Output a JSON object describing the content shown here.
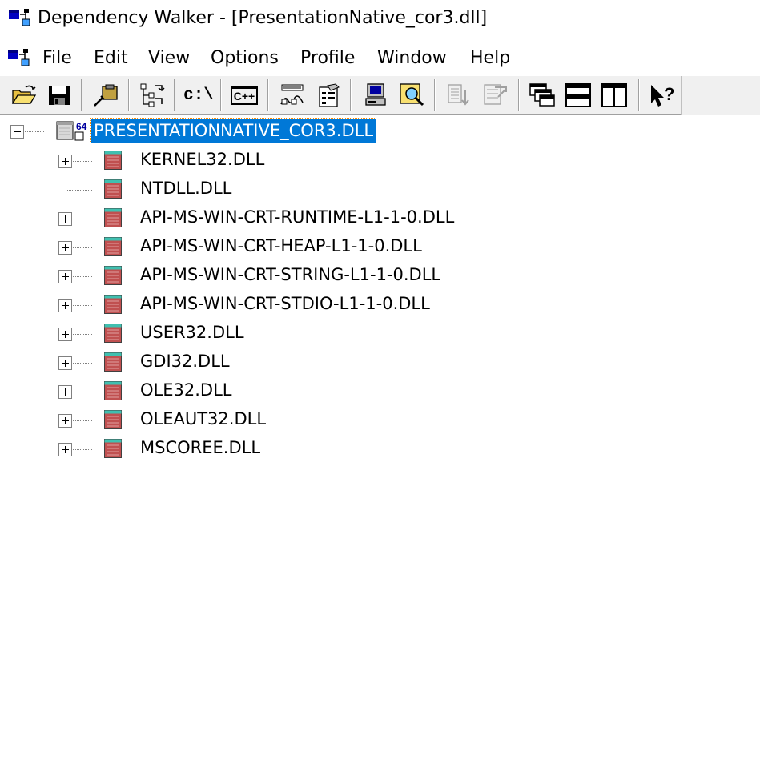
{
  "window": {
    "title": "Dependency Walker - [PresentationNative_cor3.dll]",
    "app_icon": "dependency-walker-icon"
  },
  "menu": {
    "icon": "dependency-walker-icon",
    "items": [
      "File",
      "Edit",
      "View",
      "Options",
      "Profile",
      "Window",
      "Help"
    ]
  },
  "toolbar": {
    "buttons": [
      {
        "name": "open-icon"
      },
      {
        "name": "save-icon"
      },
      {
        "name": "copy-icon"
      },
      {
        "name": "view-full-paths-icon",
        "text": ""
      },
      {
        "name": "path-icon",
        "text": "c:\\"
      },
      {
        "name": "undecorate-cpp-icon",
        "text": "C++"
      },
      {
        "name": "view-modules-icon"
      },
      {
        "name": "properties-icon"
      },
      {
        "name": "system-information-icon"
      },
      {
        "name": "external-viewer-icon"
      },
      {
        "name": "highlight-matching-item-icon"
      },
      {
        "name": "highlight-module-icon"
      },
      {
        "name": "previous-window-icon"
      },
      {
        "name": "tile-horizontal-icon"
      },
      {
        "name": "tile-vertical-icon"
      },
      {
        "name": "help-icon"
      }
    ]
  },
  "tree": {
    "root": {
      "label": "PRESENTATIONNATIVE_COR3.DLL",
      "badge": "64",
      "expanded": true,
      "selected": true
    },
    "children": [
      {
        "label": "KERNEL32.DLL",
        "expandable": true
      },
      {
        "label": "NTDLL.DLL",
        "expandable": false
      },
      {
        "label": "API-MS-WIN-CRT-RUNTIME-L1-1-0.DLL",
        "expandable": true
      },
      {
        "label": "API-MS-WIN-CRT-HEAP-L1-1-0.DLL",
        "expandable": true
      },
      {
        "label": "API-MS-WIN-CRT-STRING-L1-1-0.DLL",
        "expandable": true
      },
      {
        "label": "API-MS-WIN-CRT-STDIO-L1-1-0.DLL",
        "expandable": true
      },
      {
        "label": "USER32.DLL",
        "expandable": true
      },
      {
        "label": "GDI32.DLL",
        "expandable": true
      },
      {
        "label": "OLE32.DLL",
        "expandable": true
      },
      {
        "label": "OLEAUT32.DLL",
        "expandable": true
      },
      {
        "label": "MSCOREE.DLL",
        "expandable": true
      }
    ]
  },
  "colors": {
    "selection": "#0078d7",
    "dll_icon": "#c05050",
    "dll_header": "#40c0b0"
  }
}
